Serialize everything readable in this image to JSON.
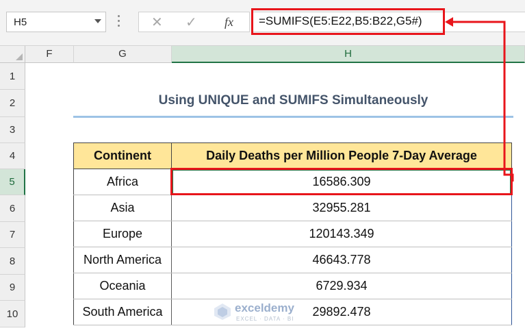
{
  "formula_bar": {
    "name_box": "H5",
    "cancel_icon": "x-icon",
    "enter_icon": "check-icon",
    "fx_label": "fx",
    "formula": "=SUMIFS(E5:E22,B5:B22,G5#)"
  },
  "columns": [
    "F",
    "G",
    "H"
  ],
  "rows": [
    "1",
    "2",
    "3",
    "4",
    "5",
    "6",
    "7",
    "8",
    "9",
    "10"
  ],
  "sheet": {
    "title": "Using UNIQUE and SUMIFS  Simultaneously",
    "table": {
      "headers": [
        "Continent",
        "Daily Deaths  per Million People 7-Day Average"
      ],
      "rows": [
        [
          "Africa",
          "16586.309"
        ],
        [
          "Asia",
          "32955.281"
        ],
        [
          "Europe",
          "120143.349"
        ],
        [
          "North America",
          "46643.778"
        ],
        [
          "Oceania",
          "6729.934"
        ],
        [
          "South America",
          "29892.478"
        ]
      ]
    }
  },
  "watermark": {
    "brand": "exceldemy",
    "tagline": "EXCEL · DATA · BI"
  },
  "colors": {
    "highlight": "#e8151b",
    "header_fill": "#ffe699",
    "selection": "#217346"
  }
}
